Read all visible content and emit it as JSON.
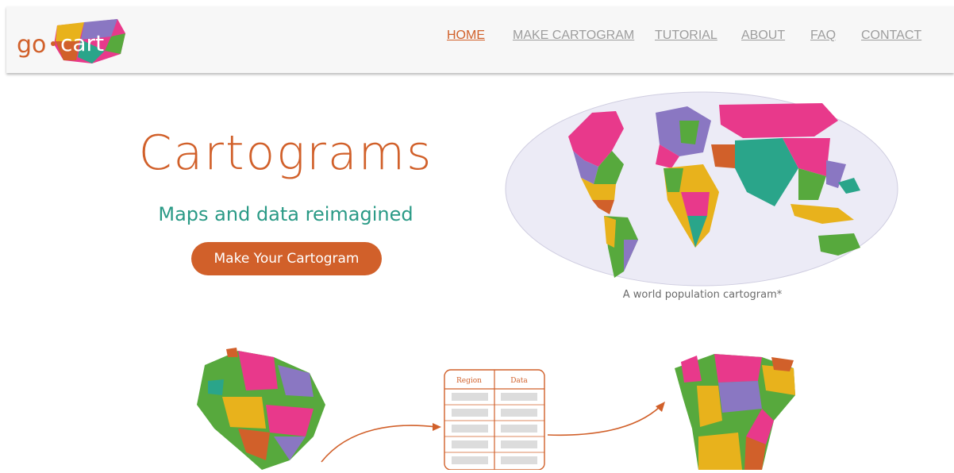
{
  "brand": {
    "logo_text_a": "go",
    "logo_text_b": "cart"
  },
  "nav": {
    "items": [
      {
        "label": "HOME",
        "active": true
      },
      {
        "label": "MAKE CARTOGRAM",
        "active": false
      },
      {
        "label": "TUTORIAL",
        "active": false
      },
      {
        "label": "ABOUT",
        "active": false
      },
      {
        "label": "FAQ",
        "active": false
      },
      {
        "label": "CONTACT",
        "active": false
      }
    ]
  },
  "hero": {
    "title": "Cartograms",
    "subtitle": "Maps and data reimagined",
    "cta_label": "Make Your Cartogram"
  },
  "world_map": {
    "caption": "A world population cartogram*"
  },
  "illustration": {
    "table_headers": [
      "Region",
      "Data"
    ]
  },
  "colors": {
    "accent": "#d1602a",
    "teal": "#2a9a86",
    "nav_inactive": "#9d9d9d",
    "region_palette": [
      "#e8398b",
      "#57a93d",
      "#8a77c2",
      "#e8b21c",
      "#d1602a",
      "#2aa58a"
    ]
  }
}
